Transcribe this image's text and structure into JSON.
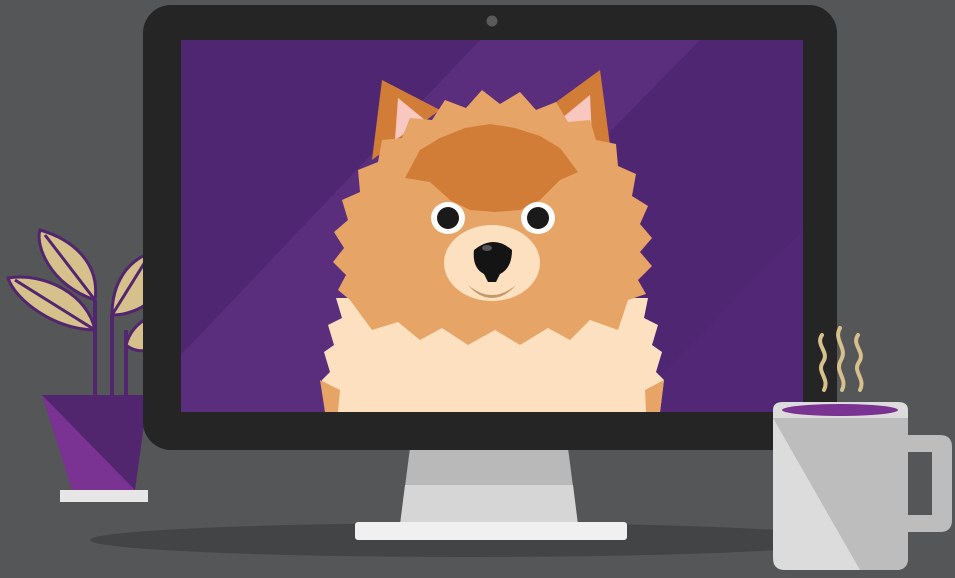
{
  "scene": {
    "subject": "pomeranian",
    "objects": [
      "desk-shadow",
      "potted-plant",
      "computer-monitor",
      "webcam",
      "dog-on-screen",
      "coffee-mug",
      "steam"
    ]
  },
  "colors": {
    "background": "#555657",
    "desk_shadow": "#434445",
    "monitor_bezel": "#252525",
    "screen": "#4f2671",
    "screen_glare": "#5b2f7e",
    "stand": "#b9b9b9",
    "stand_base": "#e6e6e6",
    "pot_light": "#7b3393",
    "pot_dark": "#52266f",
    "leaf": "#d6c08c",
    "mug": "#dcdcdc",
    "mug_shade": "#bdbdbd",
    "coffee": "#7b3393",
    "steam": "#d6c08c",
    "fur_dark": "#d27d37",
    "fur_mid": "#e6a466",
    "fur_light": "#fde0bf"
  }
}
